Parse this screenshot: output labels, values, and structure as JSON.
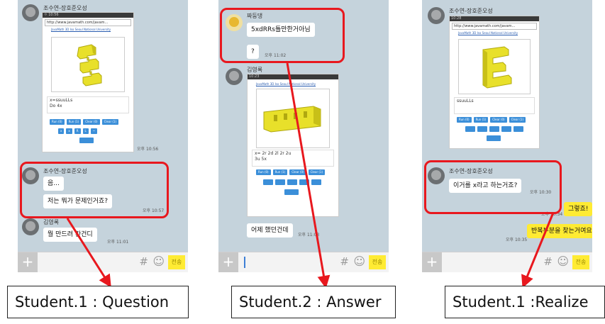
{
  "panel1": {
    "top_sender": "조수연-장호준오성",
    "browser_status": "ㅇ 10:56",
    "browser_url": "http://www.javamath.com/javam...",
    "browser_link": "JavaMath 3D Iso Seoul National University",
    "code_text": "x=ssuuLLs\nDo 4x",
    "buttons": [
      "Run (0)",
      "Run (1)",
      "Clear (0)",
      "Clear (1)"
    ],
    "buttons2": [
      "x",
      "x",
      "R",
      "L",
      "~"
    ],
    "time_top": "오후 10:56",
    "sender": "조수연-장호준오성",
    "msg1": "음...",
    "msg2": "저는 뭐가 문제인거죠?",
    "time1": "오후 10:57",
    "sender2": "김영록",
    "msg3": "뭘 만드려 칸건디",
    "time2": "오후 11:01"
  },
  "panel2": {
    "sender": "짜둥댕",
    "msg1": "5xdRRs틀만한거아님",
    "msg2": "?",
    "time1": "오후 11:02",
    "sender2": "김영록",
    "browser_status": "10:23",
    "browser_link": "JavaMath 3D Iso Seoul National University",
    "code_text": "x= 2r 2d 2l 2r 2u\n3u 5x",
    "buttons": [
      "Run (0)",
      "Run (1)",
      "Clear (0)",
      "Clear (1)"
    ],
    "msg3": "어제 했던건데",
    "time2": "오후 11:03"
  },
  "panel3": {
    "top_sender": "조수연-장호준오성",
    "browser_status": "10:28",
    "browser_url": "http://www.javamath.com/javam...",
    "browser_link": "JavaMath 3D Iso Seoul National University",
    "code_text": "ssuuLLs",
    "buttons": [
      "Run (0)",
      "Run (1)",
      "Clear (0)",
      "Clear (1)"
    ],
    "sender": "조수연-장호준오성",
    "msg1": "이거를  x라고 하는거죠?",
    "time1": "오후 10:30",
    "reply1": "그렇죠!",
    "time2": "오후 10:34",
    "reply2": "반복부분을 찾는거여요",
    "time3": "오후 10:35"
  },
  "inputbar": {
    "plus": "+",
    "hash": "#",
    "smiley": "☺",
    "send": "전송"
  },
  "captions": {
    "c1": "Student.1 : Question",
    "c2": "Student.2 : Answer",
    "c3": "Student.1 :Realize"
  },
  "colors": {
    "chat_bg": "#c5d3dc",
    "highlight": "#e8181e",
    "reply_bubble": "#ffeb33",
    "block": "#e8e02a"
  }
}
